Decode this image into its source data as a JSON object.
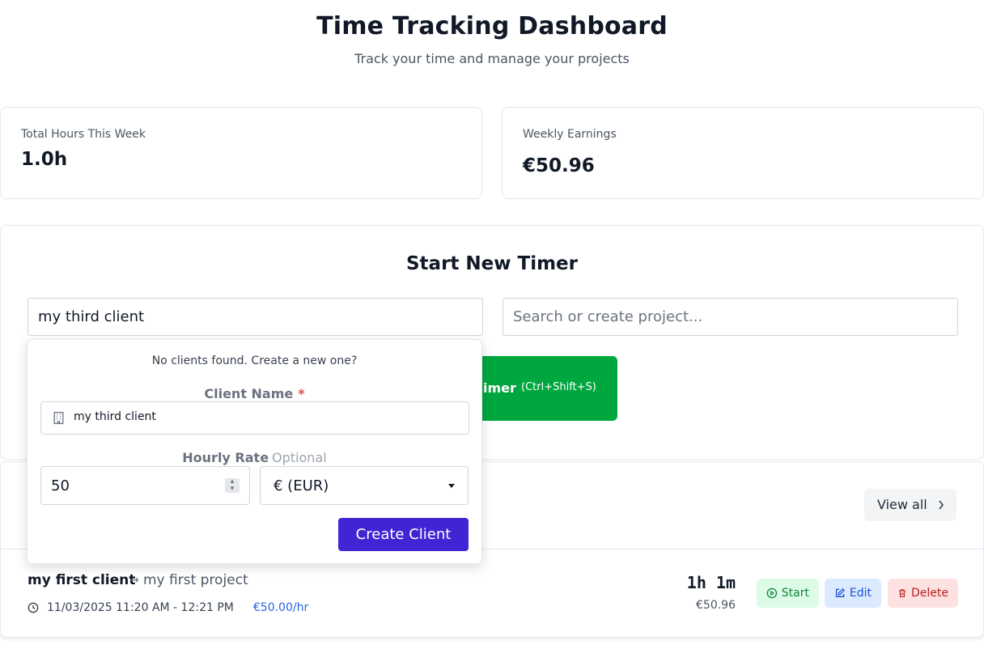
{
  "header": {
    "title": "Time Tracking Dashboard",
    "subtitle": "Track your time and manage your projects"
  },
  "stats": {
    "hours_label": "Total Hours This Week",
    "hours_value": "1.0h",
    "earnings_label": "Weekly Earnings",
    "earnings_value": "€50.96"
  },
  "timer": {
    "title": "Start New Timer",
    "client_value": "my third client",
    "project_placeholder": "Search or create project...",
    "start_label": "imer",
    "start_shortcut": "(Ctrl+Shift+S)"
  },
  "client_popup": {
    "note": "No clients found. Create a new one?",
    "client_name_label": "Client Name",
    "required_mark": "*",
    "client_name_value": "my third client",
    "hourly_rate_label": "Hourly Rate",
    "optional_label": "Optional",
    "hourly_rate_value": "50",
    "currency_value": "€ (EUR)",
    "create_label": "Create Client"
  },
  "entries": {
    "view_all_label": "View all",
    "items": [
      {
        "client": "my first client",
        "project": "my first project",
        "time_range": "11/03/2025 11:20 AM - 12:21 PM",
        "rate": "€50.00/hr",
        "duration": "1h 1m",
        "earnings": "€50.96",
        "start_label": "Start",
        "edit_label": "Edit",
        "delete_label": "Delete"
      }
    ]
  },
  "colors": {
    "start_green": "#00a63e",
    "create_purple": "#4125d4",
    "rate_blue": "#2563eb"
  }
}
